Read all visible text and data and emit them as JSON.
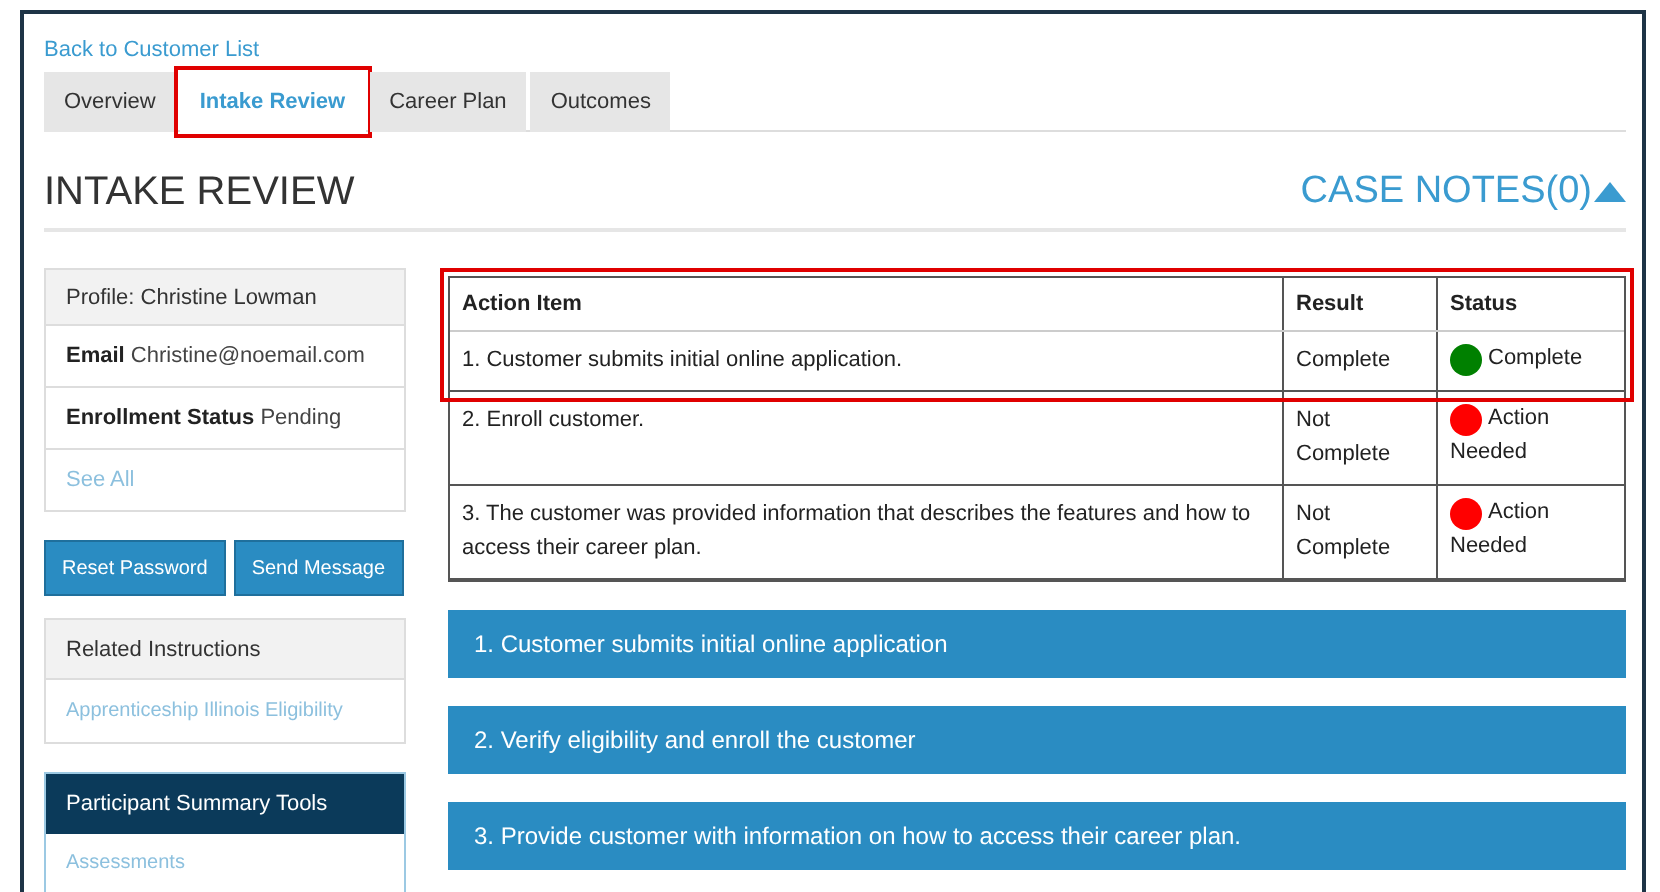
{
  "back_link": "Back to Customer List",
  "tabs": [
    {
      "label": "Overview",
      "selected": false,
      "highlighted": false
    },
    {
      "label": "Intake Review",
      "selected": true,
      "highlighted": true
    },
    {
      "label": "Career Plan",
      "selected": false,
      "highlighted": false
    },
    {
      "label": "Outcomes",
      "selected": false,
      "highlighted": false
    }
  ],
  "heading": "INTAKE REVIEW",
  "case_notes": {
    "label": "CASE NOTES(0)",
    "expanded": true
  },
  "profile": {
    "title": "Profile: Christine Lowman",
    "fields": [
      {
        "label": "Email",
        "value": "Christine@noemail.com"
      },
      {
        "label": "Enrollment Status",
        "value": "Pending"
      }
    ],
    "link": "See All"
  },
  "buttons": [
    "Reset Password",
    "Send Message"
  ],
  "related": {
    "title": "Related Instructions",
    "links": [
      "Apprenticeship Illinois Eligibility"
    ]
  },
  "tools": {
    "title": "Participant Summary Tools",
    "links": [
      "Assessments"
    ]
  },
  "table": {
    "columns": [
      "Action Item",
      "Result",
      "Status"
    ],
    "header_and_first_row_highlighted": true,
    "rows": [
      {
        "action": "1. Customer submits initial online application.",
        "result": "Complete",
        "status": "Complete",
        "color": "#008000"
      },
      {
        "action": "2. Enroll customer.",
        "result": "Not Complete",
        "status": "Action Needed",
        "color": "#ff0000"
      },
      {
        "action": "3. The customer was provided information that describes the features and how to access their career plan.",
        "result": "Not Complete",
        "status": "Action Needed",
        "color": "#ff0000"
      }
    ]
  },
  "sections": [
    "1. Customer submits initial online application",
    "2. Verify eligibility and enroll the customer",
    "3. Provide customer with information on how to access their career plan."
  ]
}
